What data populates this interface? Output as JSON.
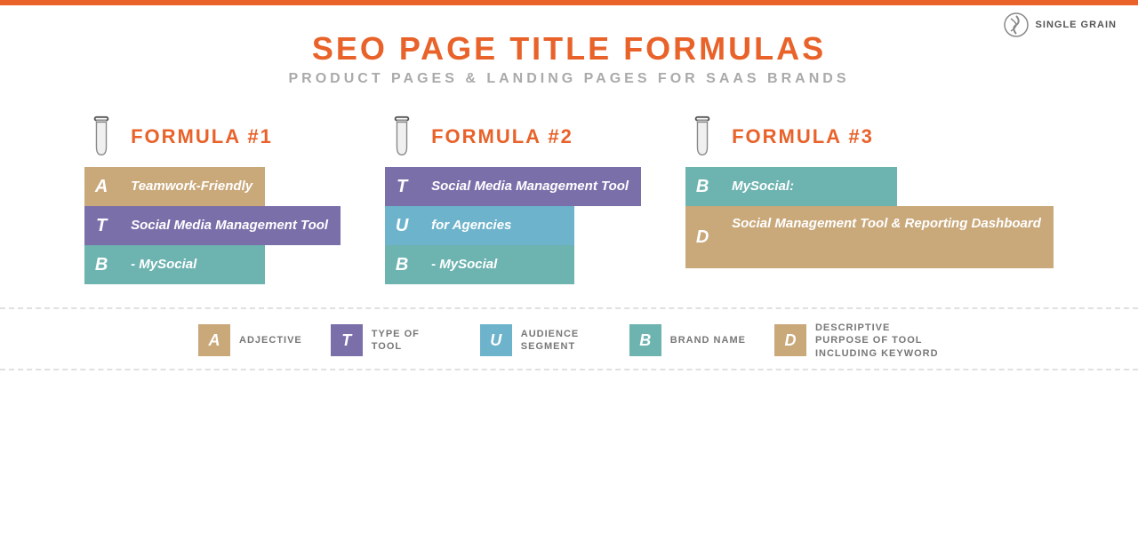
{
  "topBar": {},
  "logo": {
    "text": "SINGLE GRAIN"
  },
  "header": {
    "title_plain": "SEO PAGE TITLE ",
    "title_accent": "FORMULAS",
    "subtitle": "PRODUCT PAGES & LANDING PAGES FOR SAAS BRANDS"
  },
  "formulas": [
    {
      "id": "formula1",
      "label": "FORMULA #1",
      "rows": [
        {
          "letter": "A",
          "text": "Teamwork-Friendly",
          "letterColor": "color-tan",
          "contentColor": "color-tan"
        },
        {
          "letter": "T",
          "text": "Social Media Management Tool",
          "letterColor": "color-purple",
          "contentColor": "color-purple"
        },
        {
          "letter": "B",
          "text": "- MySocial",
          "letterColor": "color-teal",
          "contentColor": "color-teal"
        }
      ]
    },
    {
      "id": "formula2",
      "label": "FORMULA #2",
      "rows": [
        {
          "letter": "T",
          "text": "Social Media Management Tool",
          "letterColor": "color-purple",
          "contentColor": "color-purple"
        },
        {
          "letter": "U",
          "text": "for Agencies",
          "letterColor": "color-teal2",
          "contentColor": "color-teal2"
        },
        {
          "letter": "B",
          "text": "- MySocial",
          "letterColor": "color-teal",
          "contentColor": "color-teal"
        }
      ]
    },
    {
      "id": "formula3",
      "label": "FORMULA #3",
      "rows": [
        {
          "letter": "B",
          "text": "MySocial:",
          "letterColor": "color-teal",
          "contentColor": "color-teal"
        },
        {
          "letter": "D",
          "text": "Social Management Tool & Reporting Dashboard",
          "letterColor": "color-tan2",
          "contentColor": "color-tan2"
        }
      ]
    }
  ],
  "legend": [
    {
      "letter": "A",
      "color": "color-tan",
      "text": "ADJECTIVE"
    },
    {
      "letter": "T",
      "color": "color-purple",
      "text": "TYPE OF TOOL"
    },
    {
      "letter": "U",
      "color": "color-teal2",
      "text": "AUDIENCE SEGMENT"
    },
    {
      "letter": "B",
      "color": "color-teal",
      "text": "BRAND NAME"
    },
    {
      "letter": "D",
      "color": "color-tan2",
      "text": "DESCRIPTIVE PURPOSE OF TOOL INCLUDING KEYWORD"
    }
  ],
  "colors": {
    "tan": "#c9a87a",
    "purple": "#7b6faa",
    "teal": "#6db3b0",
    "orange": "#e8622a"
  }
}
